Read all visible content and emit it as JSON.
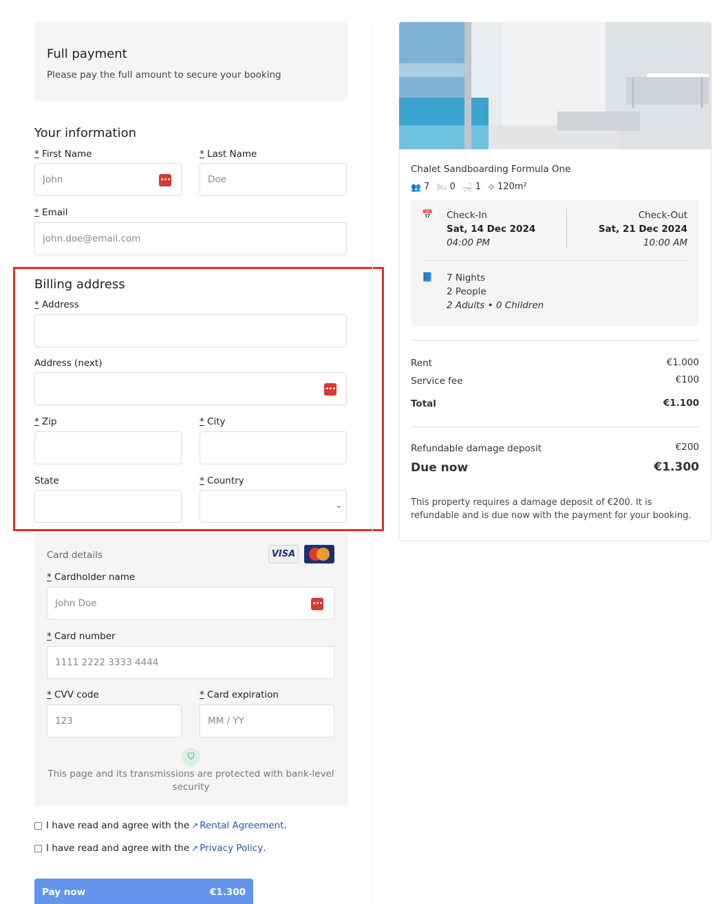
{
  "payment": {
    "title": "Full payment",
    "subtitle": "Please pay the full amount to secure your booking"
  },
  "your_info": {
    "title": "Your information",
    "first_name_label": "First Name",
    "first_name_placeholder": "John",
    "last_name_label": "Last Name",
    "last_name_placeholder": "Doe",
    "email_label": "Email",
    "email_placeholder": "john.doe@email.com"
  },
  "billing": {
    "title": "Billing address",
    "address_label": "Address",
    "address_next_label": "Address (next)",
    "zip_label": "Zip",
    "city_label": "City",
    "state_label": "State",
    "country_label": "Country"
  },
  "card": {
    "title": "Card details",
    "visa_label": "VISA",
    "holder_label": "Cardholder name",
    "holder_placeholder": "John Doe",
    "number_label": "Card number",
    "number_placeholder": "1111 2222 3333 4444",
    "cvv_label": "CVV code",
    "cvv_placeholder": "123",
    "expiry_label": "Card expiration",
    "expiry_placeholder": "MM / YY",
    "security_note": "This page and its transmissions are protected with bank-level security"
  },
  "agreements": {
    "prefix": "I have read and agree with the",
    "rental_link": "Rental Agreement",
    "privacy_link": "Privacy Policy",
    "suffix": "."
  },
  "pay_button": {
    "label": "Pay now",
    "amount": "€1.300"
  },
  "property": {
    "name": "Chalet Sandboarding Formula One",
    "guests": "7",
    "beds": "0",
    "baths": "1",
    "area": "120m²",
    "icons": [
      "people-icon",
      "bed-icon",
      "bath-icon",
      "area-icon"
    ]
  },
  "stay": {
    "checkin_label": "Check-In",
    "checkin_date": "Sat, 14 Dec 2024",
    "checkin_time": "04:00 PM",
    "checkout_label": "Check-Out",
    "checkout_date": "Sat, 21 Dec 2024",
    "checkout_time": "10:00 AM",
    "nights": "7 Nights",
    "people": "2 People",
    "breakdown": "2 Adults • 0 Children"
  },
  "prices": {
    "rent_label": "Rent",
    "rent_value": "€1.000",
    "fee_label": "Service fee",
    "fee_value": "€100",
    "total_label": "Total",
    "total_value": "€1.100",
    "deposit_label": "Refundable damage deposit",
    "deposit_value": "€200",
    "due_label": "Due now",
    "due_value": "€1.300",
    "deposit_note": "This property requires a damage deposit of €200. It is refundable and is due now with the payment for your booking."
  },
  "colors": {
    "accent": "#6495ed",
    "highlight_frame": "#e3301f",
    "link": "#2456a6"
  }
}
